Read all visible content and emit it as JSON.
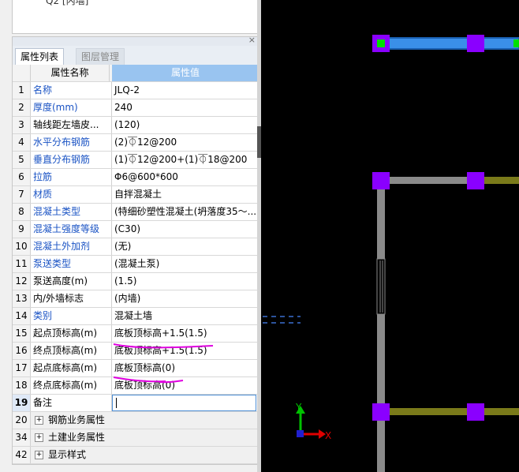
{
  "top_tree": {
    "node_label": "Q2 [内墙]"
  },
  "tabs": [
    {
      "label": "属性列表"
    },
    {
      "label": "图层管理"
    }
  ],
  "table": {
    "header": {
      "name": "属性名称",
      "value": "属性值"
    },
    "rows": [
      {
        "num": "1",
        "name": "名称",
        "value": "JLQ-2"
      },
      {
        "num": "2",
        "name": "厚度(mm)",
        "value": "240"
      },
      {
        "num": "3",
        "name": "轴线距左墙皮...",
        "value": "(120)"
      },
      {
        "num": "4",
        "name": "水平分布钢筋",
        "value": "(2)⏁12@200"
      },
      {
        "num": "5",
        "name": "垂直分布钢筋",
        "value": "(1)⏁12@200+(1)⏁18@200"
      },
      {
        "num": "6",
        "name": "拉筋",
        "value": "Φ6@600*600"
      },
      {
        "num": "7",
        "name": "材质",
        "value": "自拌混凝土"
      },
      {
        "num": "8",
        "name": "混凝土类型",
        "value": "(特细砂塑性混凝土(坍落度35～..."
      },
      {
        "num": "9",
        "name": "混凝土强度等级",
        "value": "(C30)"
      },
      {
        "num": "10",
        "name": "混凝土外加剂",
        "value": "(无)"
      },
      {
        "num": "11",
        "name": "泵送类型",
        "value": "(混凝土泵)"
      },
      {
        "num": "12",
        "name": "泵送高度(m)",
        "value": "(1.5)"
      },
      {
        "num": "13",
        "name": "内/外墙标志",
        "value": "(内墙)"
      },
      {
        "num": "14",
        "name": "类别",
        "value": "混凝土墙"
      },
      {
        "num": "15",
        "name": "起点顶标高(m)",
        "value": "底板顶标高+1.5(1.5)"
      },
      {
        "num": "16",
        "name": "终点顶标高(m)",
        "value": "底板顶标高+1.5(1.5)"
      },
      {
        "num": "17",
        "name": "起点底标高(m)",
        "value": "底板顶标高(0)"
      },
      {
        "num": "18",
        "name": "终点底标高(m)",
        "value": "底板顶标高(0)"
      },
      {
        "num": "19",
        "name": "备注",
        "value": ""
      }
    ],
    "groups": [
      {
        "num": "20",
        "label": "钢筋业务属性"
      },
      {
        "num": "34",
        "label": "土建业务属性"
      },
      {
        "num": "42",
        "label": "显示样式"
      }
    ]
  },
  "close_glyph": "×",
  "axis": {
    "y_label": "Y",
    "x_label": "X"
  },
  "colors": {
    "link_blue": "#1a53c4",
    "header_blue": "#99c4f0",
    "wall_gray": "#8a8a8a",
    "wall_olive": "#7a7a1a",
    "column_purple": "#8a00ff",
    "selected_wall": "#3a8fe8",
    "annotation_magenta": "#e000e0"
  }
}
